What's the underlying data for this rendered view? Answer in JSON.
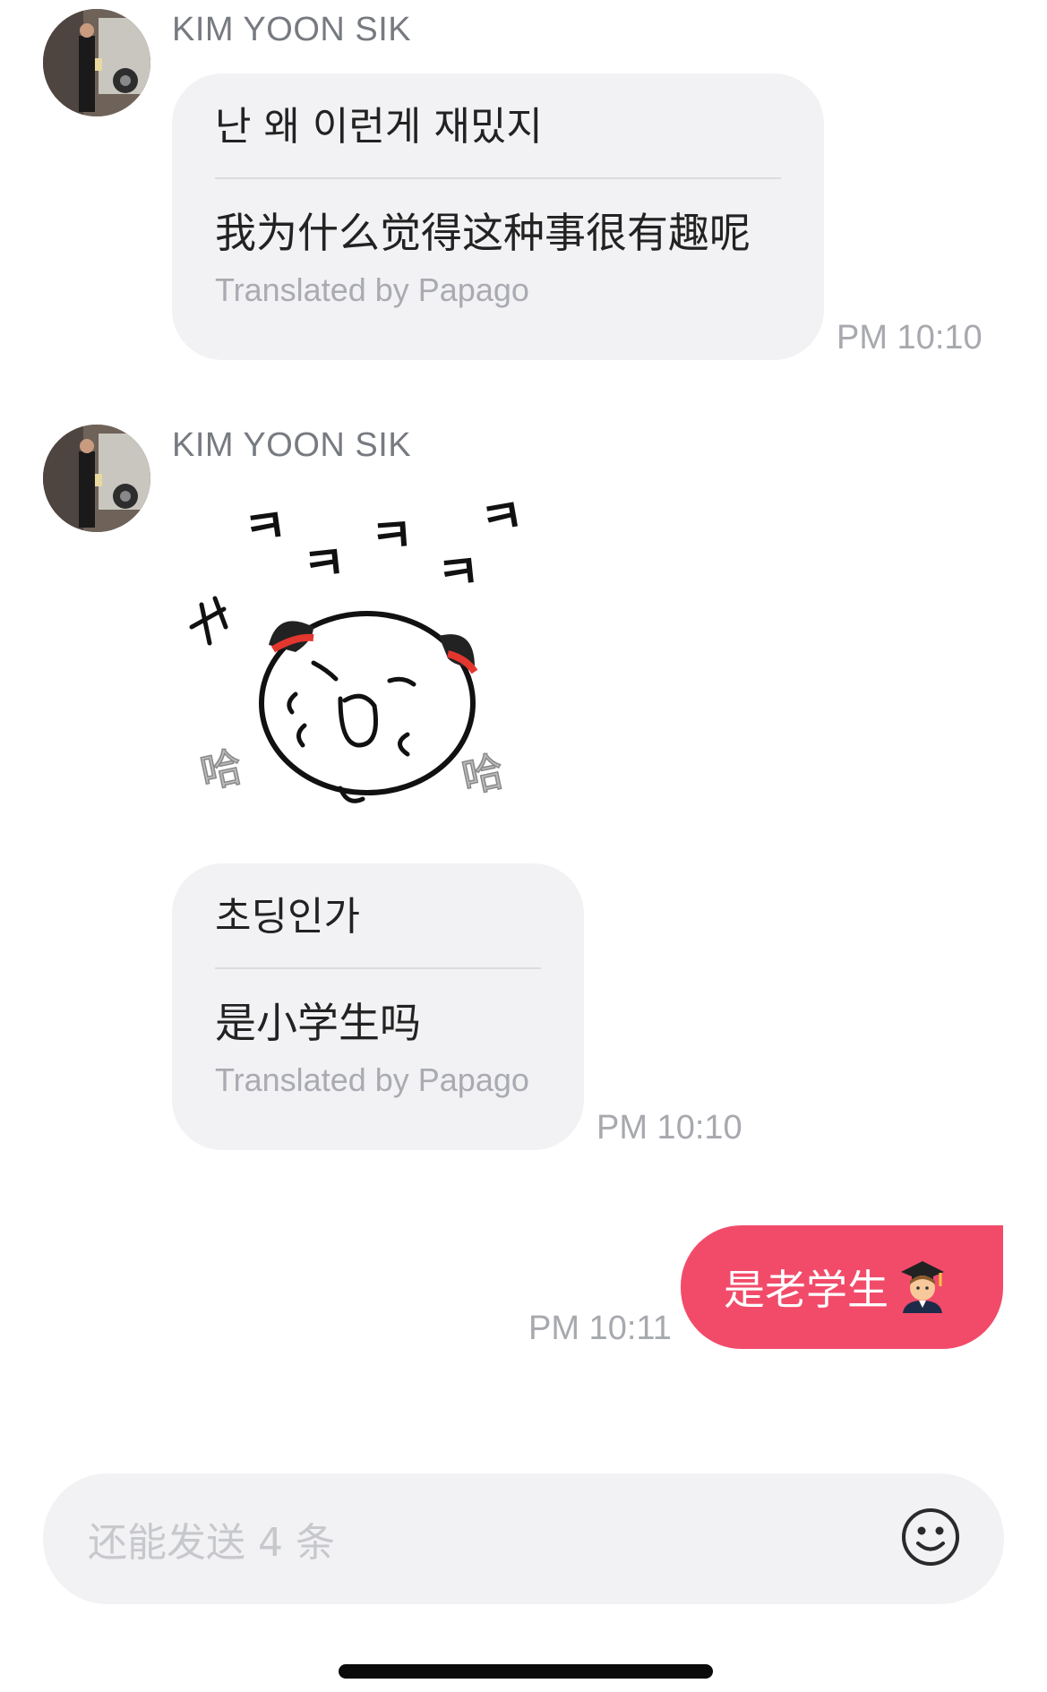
{
  "messages": [
    {
      "sender": "KIM YOON SIK",
      "original": "난 왜 이런게 재밌지",
      "translation": "我为什么觉得这种事很有趣呢",
      "credit": "Translated by Papago",
      "time": "PM 10:10"
    },
    {
      "sender": "KIM YOON SIK",
      "sticker": {
        "laugh_text": [
          "ㅋ",
          "ㅋ",
          "ㅋ",
          "ㅋ",
          "ㅋ",
          "ㅋ"
        ],
        "ha_text": [
          "哈",
          "哈"
        ]
      },
      "original": "초딩인가",
      "translation": "是小学生吗",
      "credit": "Translated by Papago",
      "time": "PM 10:10"
    },
    {
      "outgoing": true,
      "text": "是老学生",
      "emoji": "🧑‍🎓",
      "time": "PM 10:11"
    }
  ],
  "input": {
    "placeholder": "还能发送 4 条",
    "emoji_button_icon": "smiley-icon"
  },
  "colors": {
    "accent": "#f24b6a",
    "bubble_incoming": "#f2f2f4",
    "muted_text": "#a7a9ae"
  }
}
